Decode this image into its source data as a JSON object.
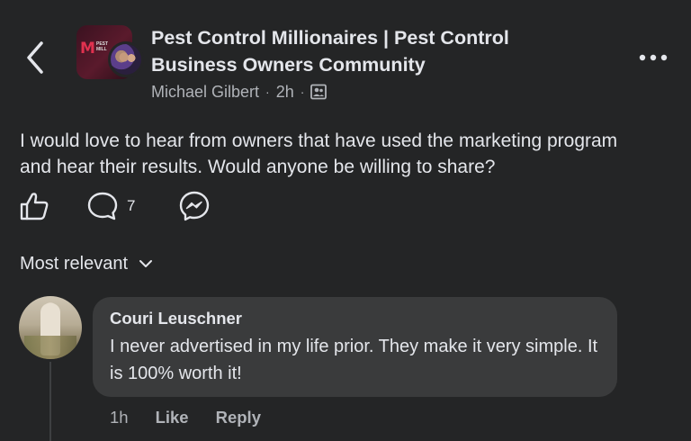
{
  "header": {
    "group_name": "Pest Control Millionaires | Pest Control Business Owners Community",
    "author": "Michael Gilbert",
    "time": "2h",
    "separator": "·",
    "privacy_icon": "group-members-icon",
    "back_icon": "chevron-left-icon",
    "more_icon": "more-horizontal-icon",
    "group_avatar_text": "M",
    "group_avatar_small_text": "PEST\nMILL"
  },
  "post": {
    "text": "I would love to hear from owners that have used the marketing program and hear their results. Would anyone be willing to share?"
  },
  "actions": {
    "like_icon": "thumbs-up-icon",
    "comment_icon": "comment-bubble-icon",
    "comment_count": "7",
    "share_icon": "messenger-icon"
  },
  "sort": {
    "label": "Most relevant",
    "icon": "chevron-down-icon"
  },
  "comments": [
    {
      "author": "Couri Leuschner",
      "text": "I never advertised in my life prior. They make it very simple. It is 100% worth it!",
      "time": "1h",
      "like_label": "Like",
      "reply_label": "Reply"
    }
  ],
  "colors": {
    "background": "#242526",
    "bubble": "#3a3b3c",
    "primary_text": "#e4e6eb",
    "secondary_text": "#b0b3b8"
  }
}
